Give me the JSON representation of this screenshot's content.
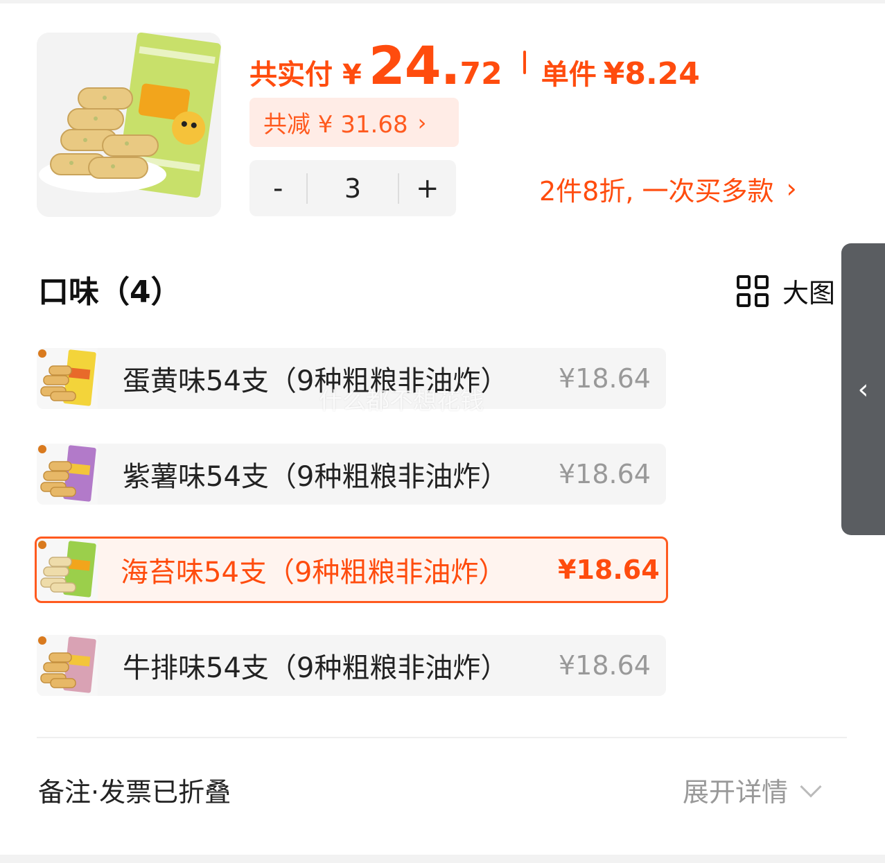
{
  "summary": {
    "total_label": "共实付",
    "currency": "¥",
    "total_int": "24.",
    "total_dec": "72",
    "unit_label": "单件",
    "unit_price": "¥8.24",
    "discount_label": "共减 ¥ 31.68",
    "discount_chevron": "›"
  },
  "stepper": {
    "minus": "-",
    "quantity": "3",
    "plus": "+"
  },
  "promo": {
    "text": "2件8折, 一次买多款",
    "chevron": "›"
  },
  "flavor_section": {
    "title": "口味（4）",
    "big_view_label": "大图",
    "big_view_icon": "grid-icon"
  },
  "options": [
    {
      "name": "蛋黄味54支（9种粗粮非油炸）",
      "price": "¥18.64",
      "selected": false,
      "accent": "#f3d43a"
    },
    {
      "name": "紫薯味54支（9种粗粮非油炸）",
      "price": "¥18.64",
      "selected": false,
      "accent": "#b27ac9"
    },
    {
      "name": "海苔味54支（9种粗粮非油炸）",
      "price": "¥18.64",
      "selected": true,
      "accent": "#9bcf4b"
    },
    {
      "name": "牛排味54支（9种粗粮非油炸）",
      "price": "¥18.64",
      "selected": false,
      "accent": "#d9a2b4"
    }
  ],
  "watermark": "什么都不想花钱",
  "side_panel": {
    "chevron": "‹"
  },
  "footer": {
    "left_text": "备注·发票已折叠",
    "right_text": "展开详情"
  },
  "colors": {
    "accent": "#ff4c0e",
    "accent_light": "#ffece6",
    "muted_text": "#999999",
    "side_panel": "#5a5d61"
  }
}
